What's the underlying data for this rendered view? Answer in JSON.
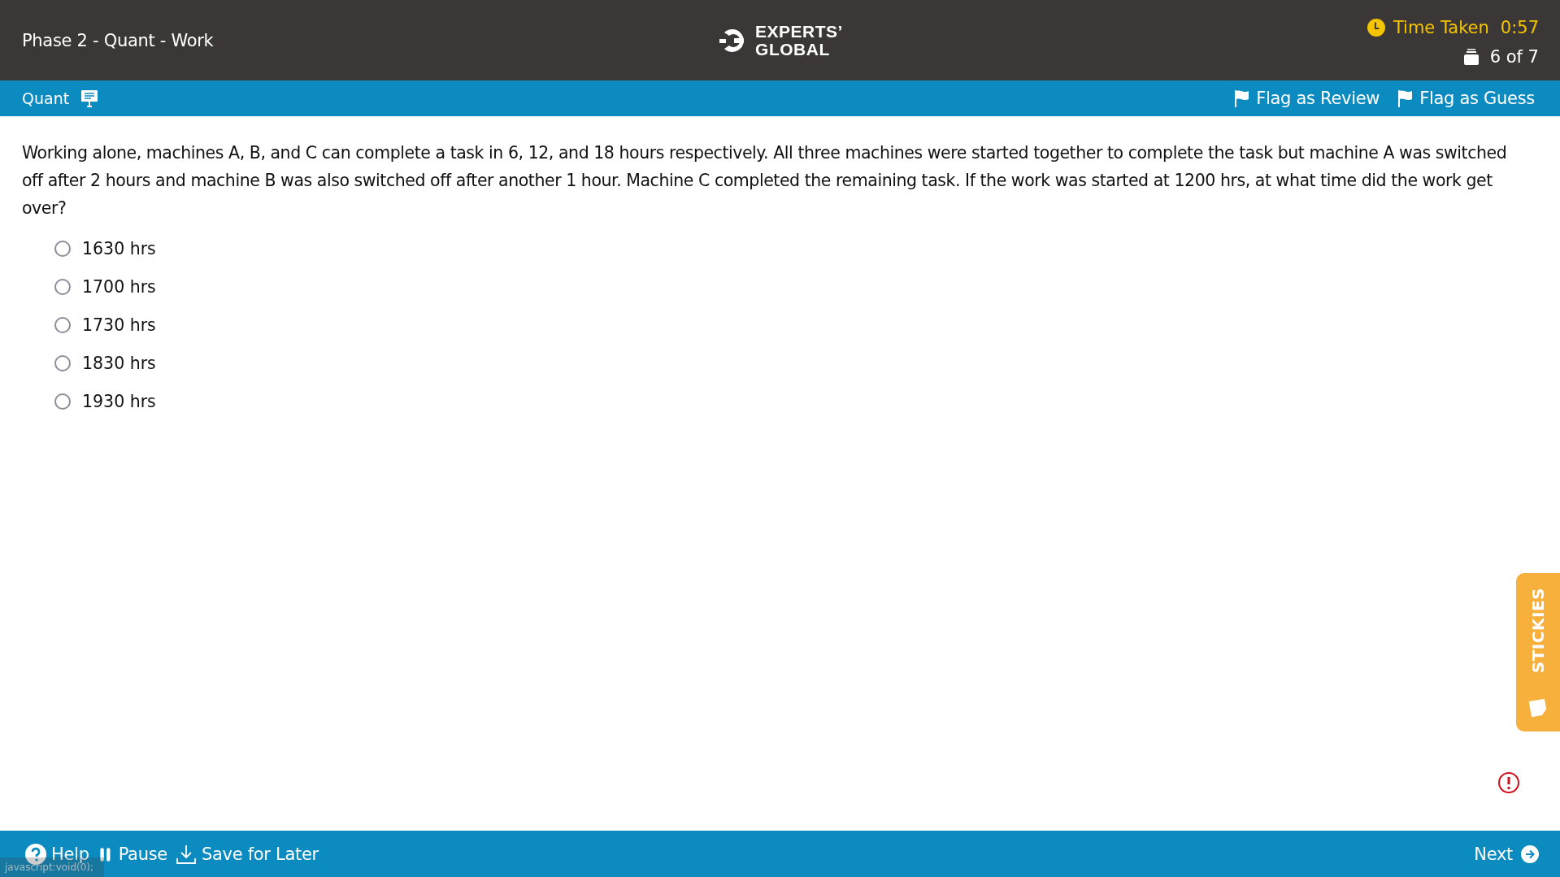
{
  "header": {
    "title": "Phase 2 - Quant - Work",
    "logo": [
      "EXPERTS’",
      "GLOBAL"
    ],
    "timer_label": "Time Taken",
    "timer_value": "0:57",
    "progress": "6 of 7"
  },
  "section_bar": {
    "section": "Quant",
    "flags": [
      {
        "label": "Flag as Review"
      },
      {
        "label": "Flag as Guess"
      }
    ]
  },
  "question": {
    "text": "Working alone, machines A, B, and C can complete a task in 6, 12, and 18 hours respectively. All three machines were started together to complete the task but machine A was switched off after 2 hours and machine B was also switched off after another 1 hour. Machine C completed the remaining task. If the work was started at 1200 hrs, at what time did the work get over?",
    "options": [
      {
        "label": "1630 hrs",
        "selected": false
      },
      {
        "label": "1700 hrs",
        "selected": false
      },
      {
        "label": "1730 hrs",
        "selected": false
      },
      {
        "label": "1830 hrs",
        "selected": false
      },
      {
        "label": "1930 hrs",
        "selected": false
      }
    ]
  },
  "stickies": {
    "label": "STICKIES"
  },
  "footer": {
    "buttons": [
      {
        "kind": "help",
        "label": "Help"
      },
      {
        "kind": "pause",
        "label": "Pause"
      },
      {
        "kind": "save",
        "label": "Save for Later"
      }
    ],
    "next": "Next"
  },
  "status_tooltip": "javascript:void(0);"
}
